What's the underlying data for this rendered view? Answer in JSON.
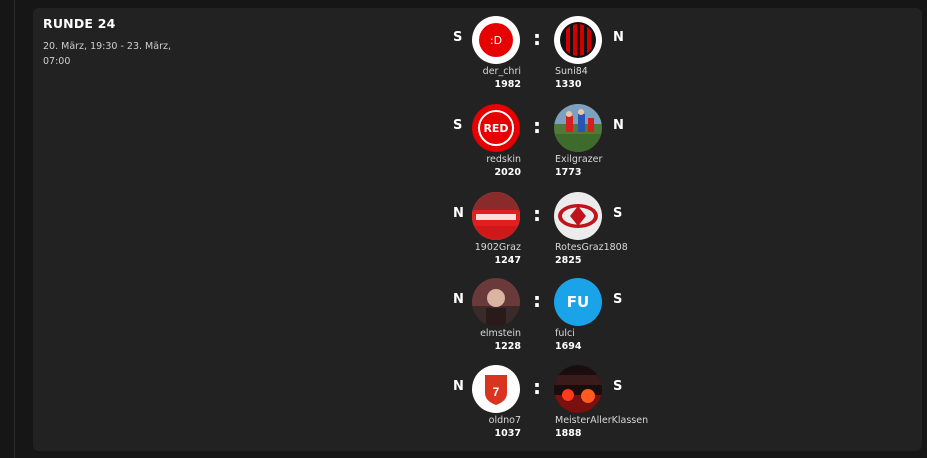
{
  "round": {
    "title": "RUNDE 24",
    "date": "20. März, 19:30 - 23. März, 07:00"
  },
  "separator": ":",
  "matches": [
    {
      "home": {
        "result": "S",
        "name": "der_chri",
        "score": "1982",
        "avatar_text": ":D",
        "avatar_bg": "#e60000"
      },
      "away": {
        "result": "N",
        "name": "Suni84",
        "score": "1330",
        "avatar_icon": "red-black-striped-shield-icon"
      }
    },
    {
      "home": {
        "result": "S",
        "name": "redskin",
        "score": "2020",
        "avatar_text": "RED",
        "avatar_bg": "#e60000"
      },
      "away": {
        "result": "N",
        "name": "Exilgrazer",
        "score": "1773",
        "avatar_icon": "football-photo"
      }
    },
    {
      "home": {
        "result": "N",
        "name": "1902Graz",
        "score": "1247",
        "avatar_icon": "fan-banner-photo"
      },
      "away": {
        "result": "S",
        "name": "RotesGraz1808",
        "score": "2825",
        "avatar_icon": "red-crest-icon"
      }
    },
    {
      "home": {
        "result": "N",
        "name": "elmstein",
        "score": "1228",
        "avatar_icon": "person-photo"
      },
      "away": {
        "result": "S",
        "name": "fulci",
        "score": "1694",
        "avatar_text": "FU",
        "avatar_bg": "#1aa3e8"
      }
    },
    {
      "home": {
        "result": "N",
        "name": "oldno7",
        "score": "1037",
        "avatar_text": "7",
        "avatar_icon": "red-shield-7-icon"
      },
      "away": {
        "result": "S",
        "name": "MeisterAllerKlassen",
        "score": "1888",
        "avatar_icon": "pyro-photo"
      }
    }
  ]
}
